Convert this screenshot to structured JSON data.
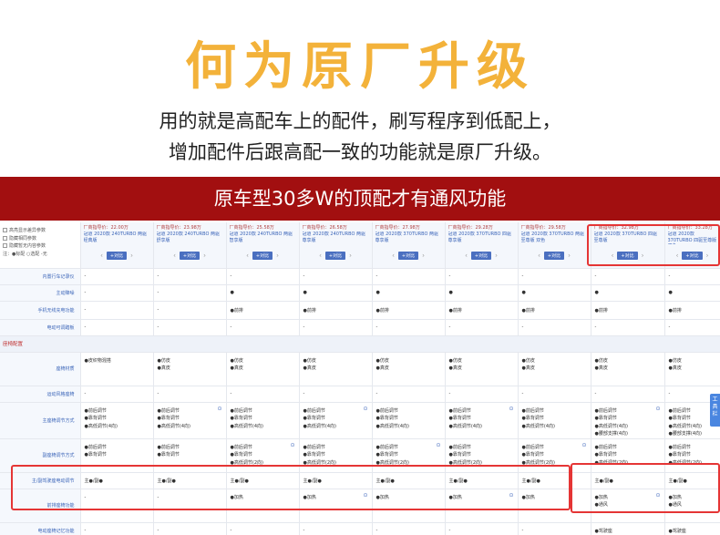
{
  "headline": "何为原厂升级",
  "sublines": [
    "用的就是高配车上的配件，刷写程序到低配上，",
    "增加配件后跟高配一致的功能就是原厂升级。"
  ],
  "banner": "原车型30多W的顶配才有通风功能",
  "options": [
    "高亮显示差异参数",
    "隐藏相同参数",
    "隐藏暂无内容参数"
  ],
  "legend": "注：●标配 ○选配 -无",
  "compare_label": "+对比",
  "cars": [
    {
      "price": "厂商指导价：22.00万",
      "model": "冠道 2020款 240TURBO 两驱经典版"
    },
    {
      "price": "厂商指导价：23.98万",
      "model": "冠道 2020款 240TURBO 两驱舒享版"
    },
    {
      "price": "厂商指导价：25.58万",
      "model": "冠道 2020款 240TURBO 两驱智享版"
    },
    {
      "price": "厂商指导价：26.58万",
      "model": "冠道 2020款 240TURBO 两驱尊享版"
    },
    {
      "price": "厂商指导价：27.98万",
      "model": "冠道 2020款 370TURBO 两驱尊享版"
    },
    {
      "price": "厂商指导价：29.28万",
      "model": "冠道 2020款 370TURBO 四驱尊享版"
    },
    {
      "price": "厂商指导价：29.58万",
      "model": "冠道 2020款 370TURBO 两驱至尊版 双色"
    },
    {
      "price": "厂商指导价：32.98万",
      "model": "冠道 2020款 370TURBO 四驱至尊版"
    },
    {
      "price": "厂商指导价：33.28万",
      "model": "冠道 2020款 370TURBO 四驱至尊版 双色"
    }
  ],
  "rows_top": [
    {
      "label": "内置行车记录仪",
      "vals": [
        "-",
        "-",
        "-",
        "-",
        "-",
        "-",
        "-",
        "-",
        "-"
      ]
    },
    {
      "label": "主动降噪",
      "vals": [
        "-",
        "-",
        "●",
        "●",
        "●",
        "●",
        "●",
        "●",
        "●"
      ]
    },
    {
      "label": "手机无线充电功能",
      "vals": [
        "-",
        "-",
        "●前排",
        "●前排",
        "●前排",
        "●前排",
        "●前排",
        "●前排",
        "●前排"
      ]
    },
    {
      "label": "电动可调踏板",
      "vals": [
        "-",
        "-",
        "-",
        "-",
        "-",
        "-",
        "-",
        "-",
        "-"
      ]
    }
  ],
  "section_title": "座椅配置",
  "row_material": {
    "label": "座椅材质",
    "vals": [
      [
        "●皮织物混搭"
      ],
      [
        "●仿皮",
        "●真皮"
      ],
      [
        "●仿皮",
        "●真皮"
      ],
      [
        "●仿皮",
        "●真皮"
      ],
      [
        "●仿皮",
        "●真皮"
      ],
      [
        "●仿皮",
        "●真皮"
      ],
      [
        "●仿皮",
        "●真皮"
      ],
      [
        "●仿皮",
        "●真皮"
      ],
      [
        "●仿皮",
        "●真皮"
      ]
    ]
  },
  "row_sport": {
    "label": "运动风格座椅",
    "vals": [
      "-",
      "-",
      "-",
      "-",
      "-",
      "-",
      "-",
      "-",
      "-"
    ]
  },
  "row_driver": {
    "label": "主座椅调节方式",
    "vals": [
      [
        "●前后调节",
        "●靠背调节",
        "●高低调节(4向)"
      ],
      [
        "●前后调节",
        "●靠背调节",
        "●高低调节(4向)"
      ],
      [
        "●前后调节",
        "●靠背调节",
        "●高低调节(4向)"
      ],
      [
        "●前后调节",
        "●靠背调节",
        "●高低调节(4向)"
      ],
      [
        "●前后调节",
        "●靠背调节",
        "●高低调节(4向)"
      ],
      [
        "●前后调节",
        "●靠背调节",
        "●高低调节(4向)"
      ],
      [
        "●前后调节",
        "●靠背调节",
        "●高低调节(4向)"
      ],
      [
        "●前后调节",
        "●靠背调节",
        "●高低调节(4向)",
        "●腰部支撑(4向)"
      ],
      [
        "●前后调节",
        "●靠背调节",
        "●高低调节(4向)",
        "●腰部支撑(4向)"
      ]
    ]
  },
  "row_passenger": {
    "label": "副座椅调节方式",
    "vals": [
      [
        "●前后调节",
        "●靠背调节"
      ],
      [
        "●前后调节",
        "●靠背调节"
      ],
      [
        "●前后调节",
        "●靠背调节",
        "●高低调节(2向)"
      ],
      [
        "●前后调节",
        "●靠背调节",
        "●高低调节(2向)"
      ],
      [
        "●前后调节",
        "●靠背调节",
        "●高低调节(2向)"
      ],
      [
        "●前后调节",
        "●靠背调节",
        "●高低调节(2向)"
      ],
      [
        "●前后调节",
        "●靠背调节",
        "●高低调节(2向)"
      ],
      [
        "●前后调节",
        "●靠背调节",
        "●高低调节(2向)"
      ],
      [
        "●前后调节",
        "●靠背调节",
        "●高低调节(2向)"
      ]
    ]
  },
  "row_electric": {
    "label": "主/副驾驶座电动调节",
    "vals": [
      "主●/副●",
      "主●/副●",
      "主●/副●",
      "主●/副●",
      "主●/副●",
      "主●/副●",
      "主●/副●",
      "主●/副●",
      "主●/副●"
    ]
  },
  "row_front_func": {
    "label": "前排座椅功能",
    "vals": [
      [
        "-"
      ],
      [
        "-"
      ],
      [
        "●加热"
      ],
      [
        "●加热"
      ],
      [
        "●加热"
      ],
      [
        "●加热"
      ],
      [
        "●加热"
      ],
      [
        "●加热",
        "●通风"
      ],
      [
        "●加热",
        "●通风"
      ]
    ]
  },
  "row_memory": {
    "label": "电动座椅记忆功能",
    "vals": [
      "-",
      "-",
      "-",
      "-",
      "-",
      "-",
      "-",
      "●驾驶座",
      "●驾驶座"
    ]
  },
  "side_tab": "工具栏",
  "colors": {
    "headline": "#f3b23a",
    "banner": "#a20f10",
    "highlight": "#e53535",
    "link": "#3a64b8"
  }
}
